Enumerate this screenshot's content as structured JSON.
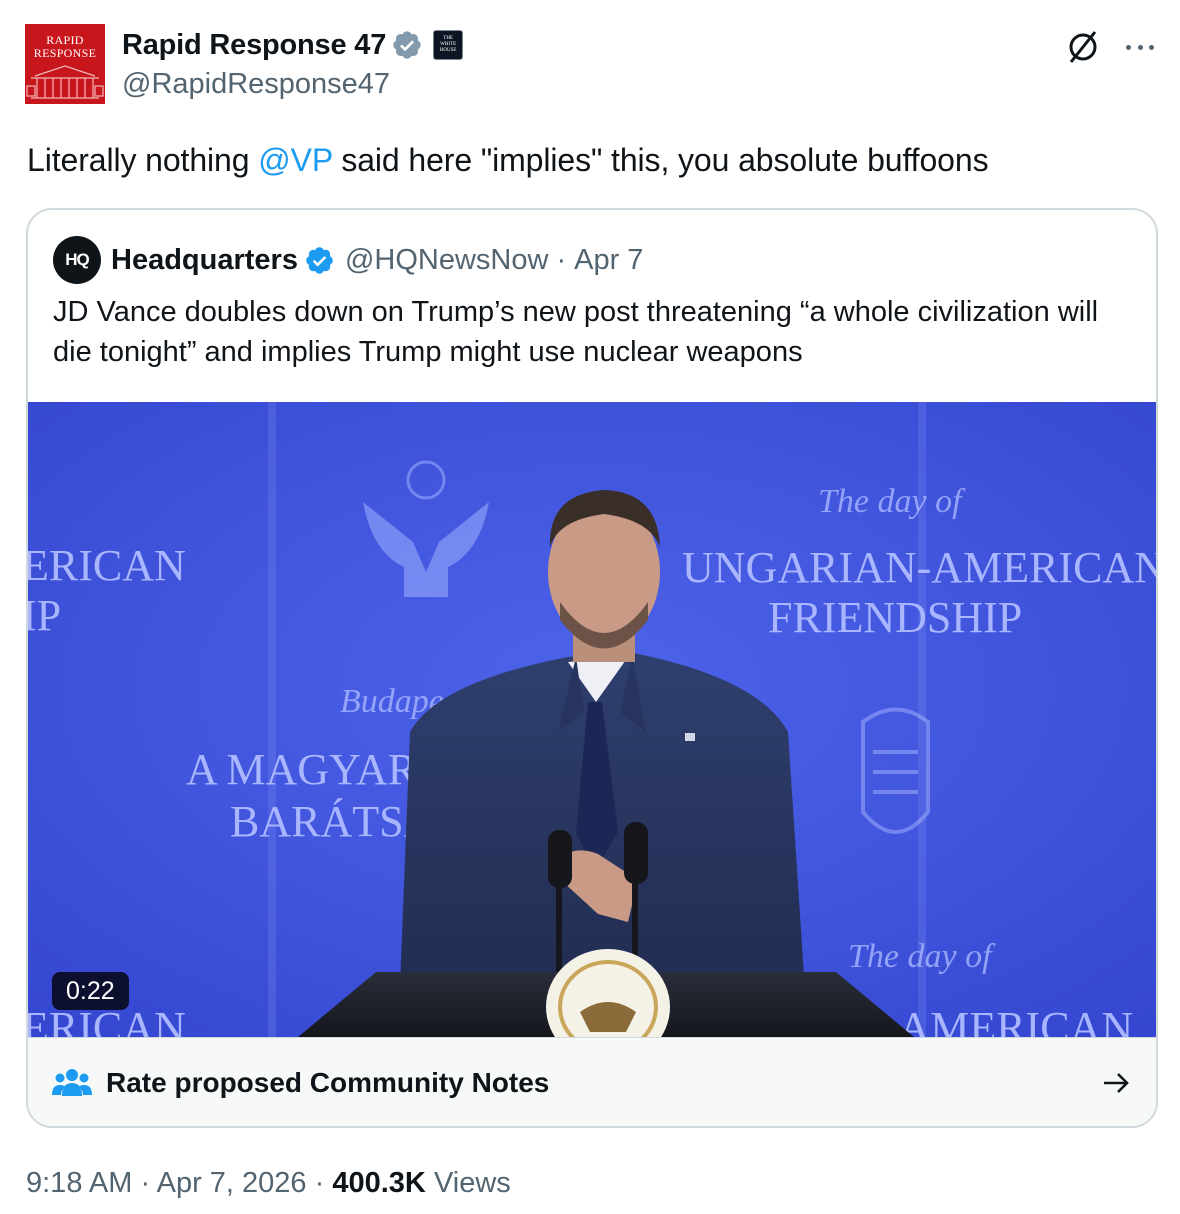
{
  "author": {
    "display_name": "Rapid Response 47",
    "handle": "@RapidResponse47",
    "avatar_text_line1": "RAPID",
    "avatar_text_line2": "RESPONSE",
    "verified_badge_color": "#829aab",
    "affiliation_badge_text_line1": "THE",
    "affiliation_badge_text_line2": "WHITE",
    "affiliation_badge_text_line3": "HOUSE"
  },
  "tweet": {
    "text_before": "Literally nothing ",
    "mention": "@VP",
    "text_after": " said here \"implies\" this, you absolute buffoons"
  },
  "quoted_tweet": {
    "avatar_text": "HQ",
    "display_name": "Headquarters",
    "handle": "@HQNewsNow",
    "separator": "·",
    "date": "Apr 7",
    "verified_badge_color": "#1d9bf0",
    "text": "JD Vance doubles down on Trump’s new post threatening “a whole civilization will die tonight” and implies Trump might use nuclear weapons",
    "video": {
      "duration": "0:22",
      "backdrop_text": {
        "left_line1": "ERICAN",
        "left_line2": "IP",
        "left_bottom": "ERICAN",
        "script1": "The day of",
        "right_line1": "UNGARIAN-AMERICAN",
        "right_line2": "FRIENDSHIP",
        "script2": "Budape",
        "magyar_line1": "A MAGYAR",
        "magyar_line2": "BARÁTSÁ",
        "script3": "The day of",
        "right_bottom": "N-AMERICAN"
      }
    },
    "community_notes_label": "Rate proposed Community Notes"
  },
  "footer": {
    "time": "9:18 AM",
    "separator": "·",
    "date": "Apr 7, 2026",
    "views_count": "400.3K",
    "views_label": "Views"
  },
  "colors": {
    "text_primary": "#0f1419",
    "text_secondary": "#536471",
    "link": "#1d9bf0",
    "border": "#cfd9de",
    "brand_red": "#c8161d",
    "backdrop_blue": "#3f55e0"
  },
  "icons": {
    "verified": "verified-badge-icon",
    "grok": "grok-icon",
    "more": "more-options-icon",
    "community_notes": "community-notes-icon",
    "arrow": "arrow-right-icon"
  }
}
